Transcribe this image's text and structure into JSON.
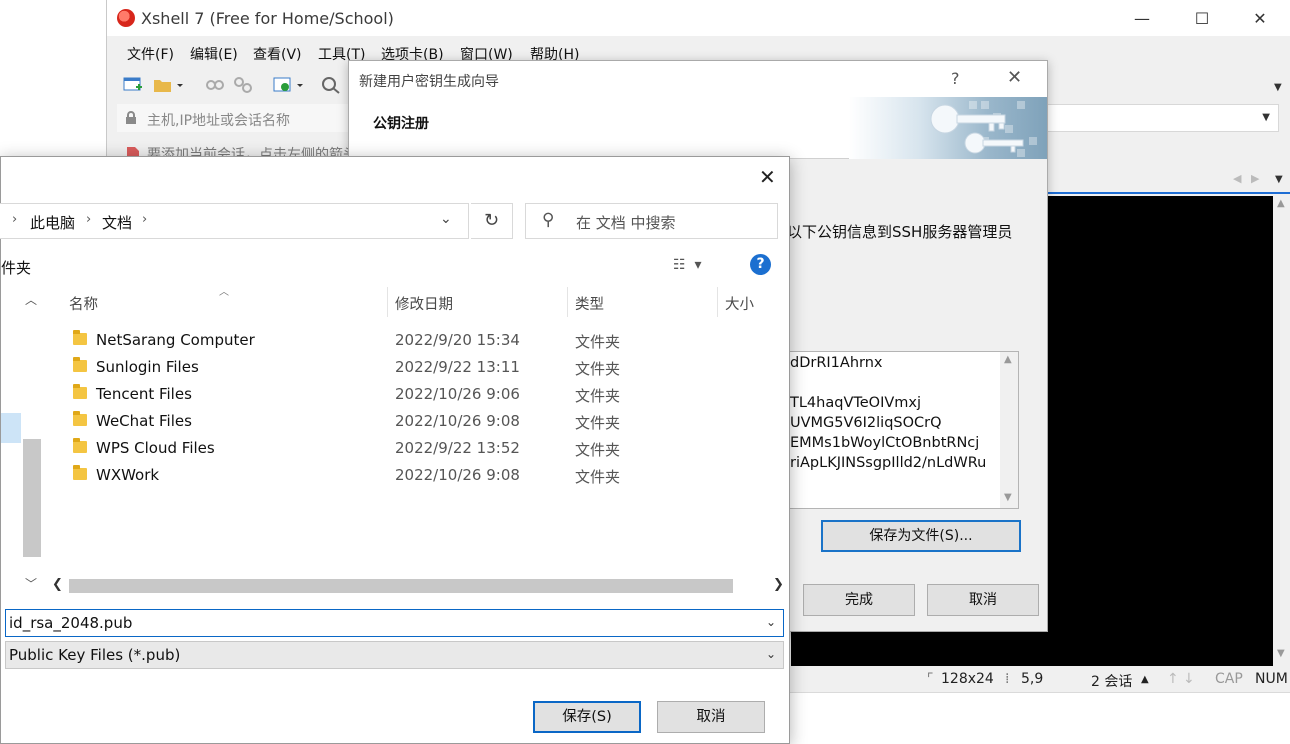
{
  "xshell": {
    "title": "Xshell 7 (Free for Home/School)",
    "menu": [
      "文件(F)",
      "编辑(E)",
      "查看(V)",
      "工具(T)",
      "选项卡(B)",
      "窗口(W)",
      "帮助(H)"
    ],
    "address_placeholder": "主机,IP地址或会话名称",
    "hint": "要添加当前会话，点击左侧的箭头按钮。",
    "status": {
      "size": "128x24",
      "cursor": "5,9",
      "sessions": "2 会话",
      "caps": "CAP",
      "num": "NUM"
    }
  },
  "wizard": {
    "title": "新建用户密钥生成向导",
    "header": "公钥注册",
    "description": "以下公钥信息到SSH服务器管理员",
    "key_lines": [
      "dDrRI1Ahrnx",
      "",
      "TL4haqVTeOIVmxj",
      "UVMG5V6I2liqSOCrQ",
      "EMMs1bWoylCtOBnbtRNcj",
      "riApLKJINSsgpIlld2/nLdWRu"
    ],
    "save_file_button": "保存为文件(S)...",
    "finish_button": "完成",
    "cancel_button": "取消"
  },
  "save_dialog": {
    "breadcrumb": [
      "此电脑",
      "文档"
    ],
    "search_placeholder": "在 文档 中搜索",
    "new_folder": "件夹",
    "columns": {
      "name": "名称",
      "modified": "修改日期",
      "type": "类型",
      "size": "大小"
    },
    "files": [
      {
        "name": "NetSarang Computer",
        "modified": "2022/9/20 15:34",
        "type": "文件夹"
      },
      {
        "name": "Sunlogin Files",
        "modified": "2022/9/22 13:11",
        "type": "文件夹"
      },
      {
        "name": "Tencent Files",
        "modified": "2022/10/26 9:06",
        "type": "文件夹"
      },
      {
        "name": "WeChat Files",
        "modified": "2022/10/26 9:08",
        "type": "文件夹"
      },
      {
        "name": "WPS Cloud Files",
        "modified": "2022/9/22 13:52",
        "type": "文件夹"
      },
      {
        "name": "WXWork",
        "modified": "2022/10/26 9:08",
        "type": "文件夹"
      }
    ],
    "file_name": "id_rsa_2048.pub",
    "file_type": "Public Key Files (*.pub)",
    "save_button": "保存(S)",
    "cancel_button": "取消"
  },
  "colors": {
    "accent": "#0a67c6",
    "terminal_bg": "#000000",
    "folder": "#f4c542"
  }
}
